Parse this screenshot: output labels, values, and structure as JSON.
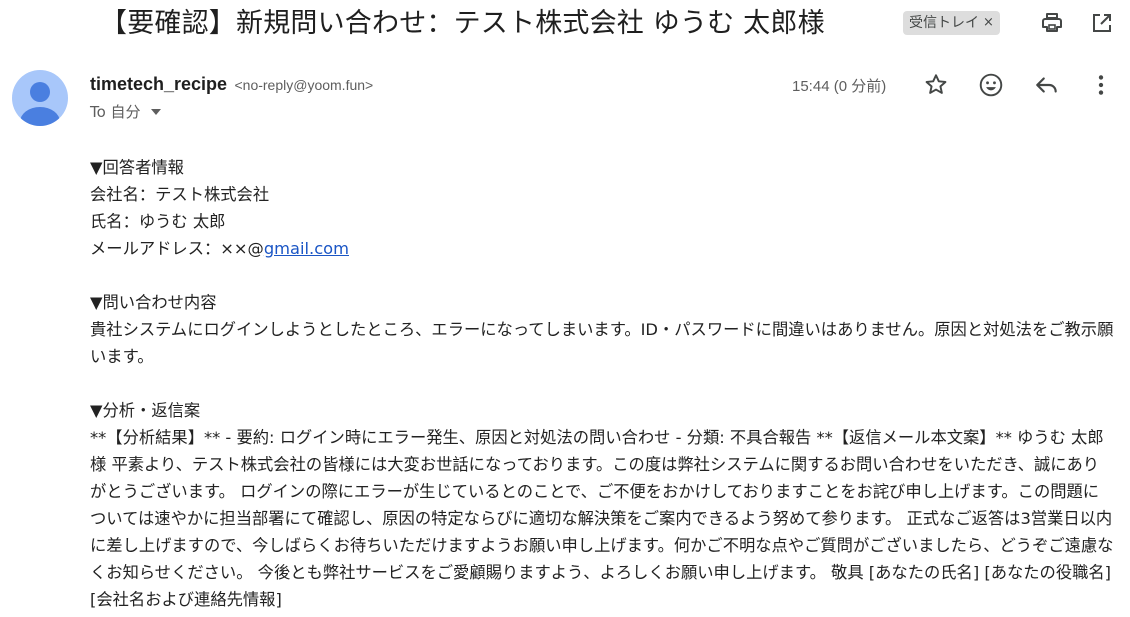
{
  "subject": {
    "title": "【要確認】新規問い合わせ：テスト株式会社 ゆうむ 太郎様",
    "label": "受信トレイ",
    "label_remove": "×"
  },
  "toolbar_icons": [
    "print-icon",
    "open-in-new-window-icon"
  ],
  "sender": {
    "name": "timetech_recipe",
    "address": "<no-reply@yoom.fun>",
    "to_label": "To 自分",
    "time": "15:44 (0 分前)"
  },
  "actions": [
    "star-icon",
    "emoji-reaction-icon",
    "reply-icon",
    "more-options-icon"
  ],
  "body": {
    "respondent_heading": "▼回答者情報",
    "company_line": "会社名：テスト株式会社",
    "name_line": "氏名：ゆうむ 太郎",
    "email_prefix": "メールアドレス：××@",
    "email_link": "gmail.com",
    "inquiry_heading": "▼問い合わせ内容",
    "inquiry_text": "貴社システムにログインしようとしたところ、エラーになってしまいます。ID・パスワードに間違いはありません。原因と対処法をご教示願います。",
    "analysis_heading": "▼分析・返信案",
    "analysis_text": "**【分析結果】** - 要約: ログイン時にエラー発生、原因と対処法の問い合わせ - 分類: 不具合報告 **【返信メール本文案】** ゆうむ 太郎様 平素より、テスト株式会社の皆様には大変お世話になっております。この度は弊社システムに関するお問い合わせをいただき、誠にありがとうございます。 ログインの際にエラーが生じているとのことで、ご不便をおかけしておりますことをお詫び申し上げます。この問題については速やかに担当部署にて確認し、原因の特定ならびに適切な解決策をご案内できるよう努めて参ります。 正式なご返答は3営業日以内に差し上げますので、今しばらくお待ちいただけますようお願い申し上げます。何かご不明な点やご質問がございましたら、どうぞご遠慮なくお知らせください。 今後とも弊社サービスをご愛顧賜りますよう、よろしくお願い申し上げます。 敬具 [あなたの氏名] [あなたの役職名] [会社名および連絡先情報]"
  },
  "colors": {
    "avatar_bg": "#a8c7fa",
    "avatar_fg": "#4a7fe0",
    "link": "#1a55c5",
    "icon": "#444746"
  }
}
